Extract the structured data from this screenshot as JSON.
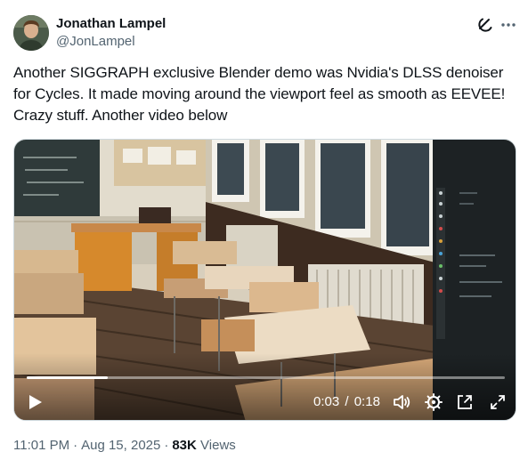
{
  "author": {
    "name": "Jonathan Lampel",
    "handle": "@JonLampel",
    "avatar": "avatar-photo"
  },
  "tweet": {
    "text": "Another SIGGRAPH exclusive Blender demo was Nvidia's DLSS denoiser for Cycles. It made moving around the viewport feel as smooth as EEVEE! Crazy stuff. Another video below"
  },
  "icons": {
    "grok": "grok-icon",
    "more": "more-icon"
  },
  "video": {
    "current_time": "0:03",
    "duration": "0:18",
    "separator": "/",
    "progress": 0.17
  },
  "meta": {
    "time": "11:01 PM",
    "date": "Aug 15, 2025",
    "views_count": "83K",
    "views_label": "Views"
  }
}
